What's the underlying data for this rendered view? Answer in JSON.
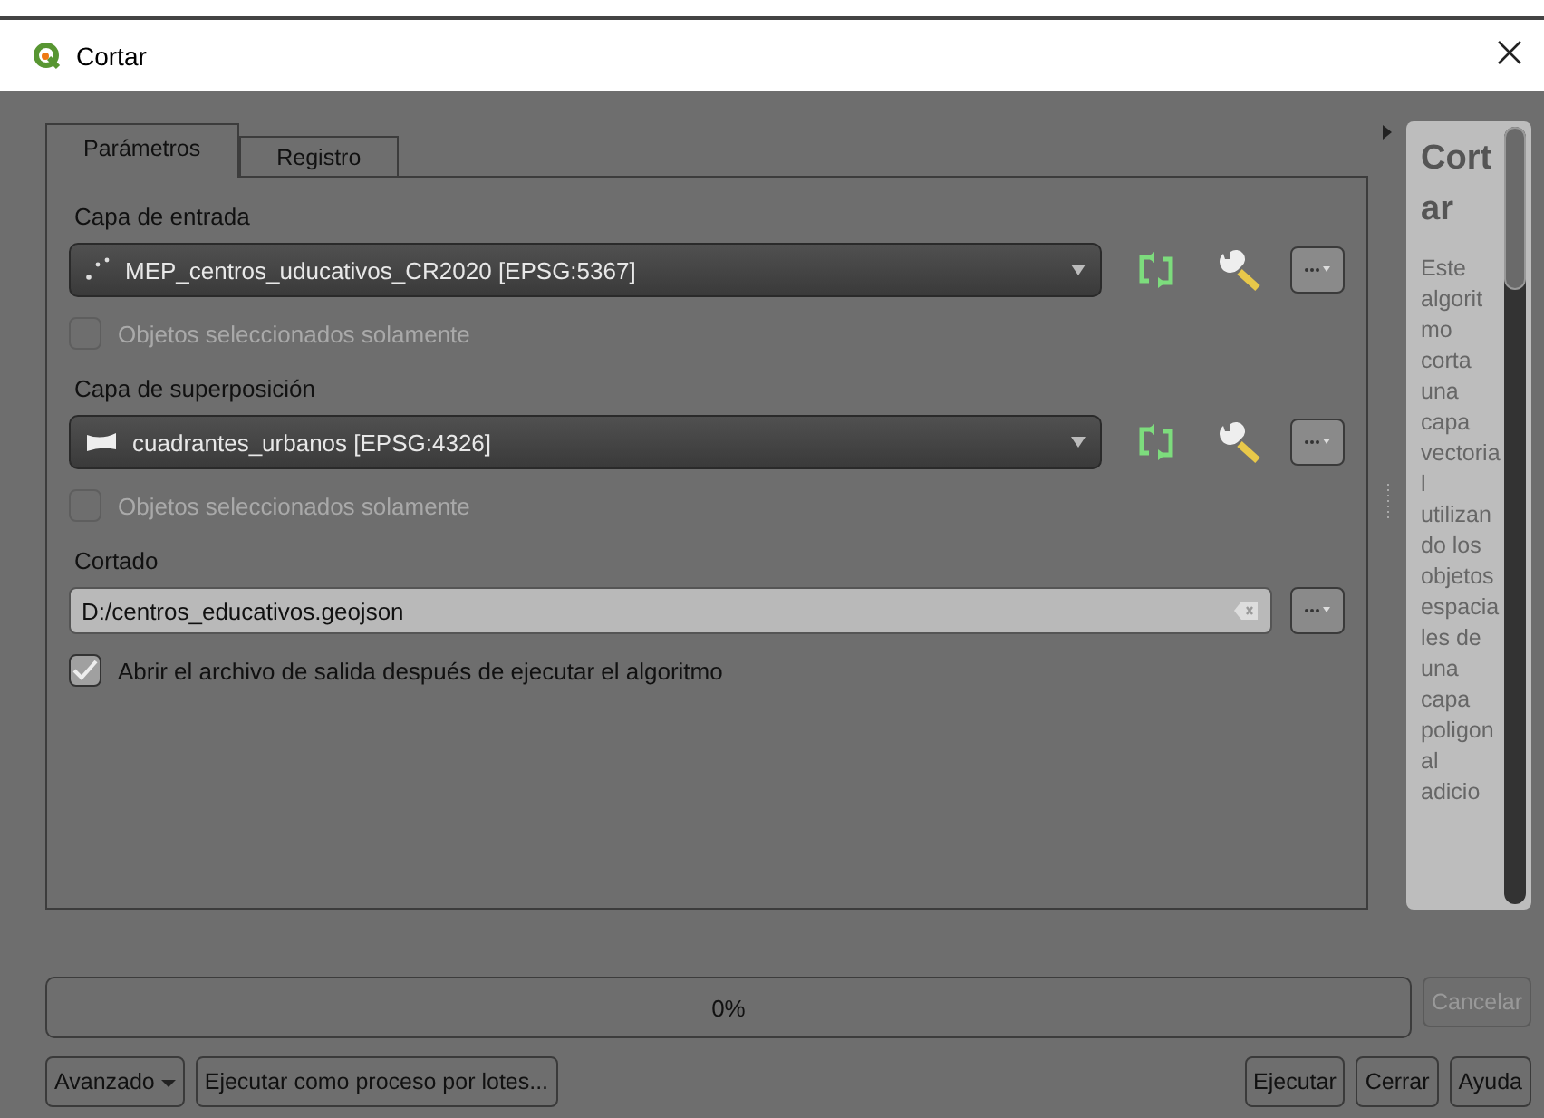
{
  "window": {
    "title": "Cortar"
  },
  "tabs": [
    {
      "label": "Parámetros",
      "selected": true
    },
    {
      "label": "Registro",
      "selected": false
    }
  ],
  "parameters": [
    {
      "kind": "point_layer",
      "label": "Capa de entrada",
      "value": "MEP_centros_uducativos_CR2020 [EPSG:5367]",
      "option": {
        "label": "Objetos seleccionados solamente",
        "checked": false,
        "disabled": true
      }
    },
    {
      "kind": "polygon_layer",
      "label": "Capa de superposición",
      "value": "cuadrantes_urbanos [EPSG:4326]",
      "option": {
        "label": "Objetos seleccionados solamente",
        "checked": false,
        "disabled": true
      }
    },
    {
      "kind": "file",
      "label": "Cortado",
      "value": "D:/centros_educativos.geojson",
      "option": {
        "label": "Abrir el archivo de salida después de ejecutar el algoritmo",
        "checked": true,
        "disabled": false
      }
    }
  ],
  "help": {
    "title": "Cortar",
    "text": "Este algoritmo corta una capa vectorial utilizando los objetos espaciales de una capa poligonal adicio"
  },
  "progress": {
    "level": 0,
    "reading": "0%"
  },
  "cancel_button": {
    "label": "Cancelar",
    "disabled": true
  },
  "left_buttons": [
    {
      "label": "Avanzado",
      "kind": "menu"
    },
    {
      "label": "Ejecutar como proceso por lotes...",
      "kind": "plain"
    }
  ],
  "right_buttons": [
    "Ejecutar",
    "Cerrar",
    "Ayuda"
  ]
}
